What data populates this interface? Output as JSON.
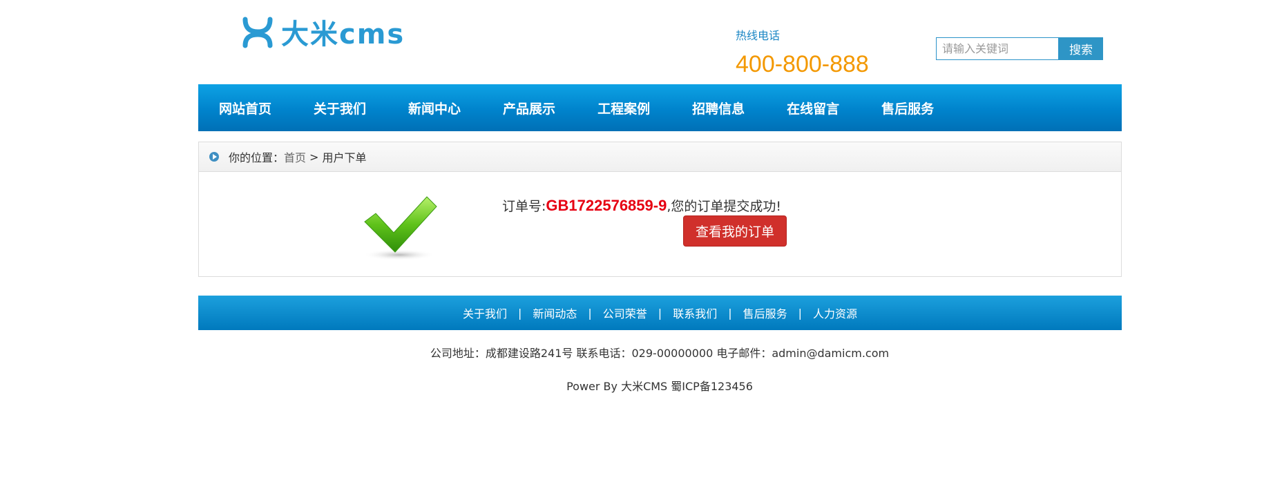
{
  "header": {
    "logo_text": "大米cms",
    "hotline_label": "热线电话",
    "hotline_number": "400-800-888",
    "search_placeholder": "请输入关键词",
    "search_button": "搜索"
  },
  "nav": {
    "items": [
      "网站首页",
      "关于我们",
      "新闻中心",
      "产品展示",
      "工程案例",
      "招聘信息",
      "在线留言",
      "售后服务"
    ]
  },
  "breadcrumb": {
    "prefix": "你的位置：",
    "home": "首页",
    "separator": ">",
    "current": "用户下单"
  },
  "order": {
    "label": "订单号:",
    "number": "GB1722576859-9",
    "message": ",您的订单提交成功!",
    "view_button": "查看我的订单"
  },
  "footer": {
    "links": [
      "关于我们",
      "新闻动态",
      "公司荣誉",
      "联系我们",
      "售后服务",
      "人力资源"
    ],
    "pipe": "|",
    "address": "公司地址：成都建设路241号 联系电话：029-00000000 电子邮件：admin@damicm.com",
    "powered": "Power By 大米CMS  蜀ICP备123456"
  },
  "colors": {
    "brand": "#2a9ad3",
    "hotline": "#f39800",
    "nav_bg": "#0083cc",
    "order_number": "#e60012",
    "button_red": "#d0302b"
  }
}
